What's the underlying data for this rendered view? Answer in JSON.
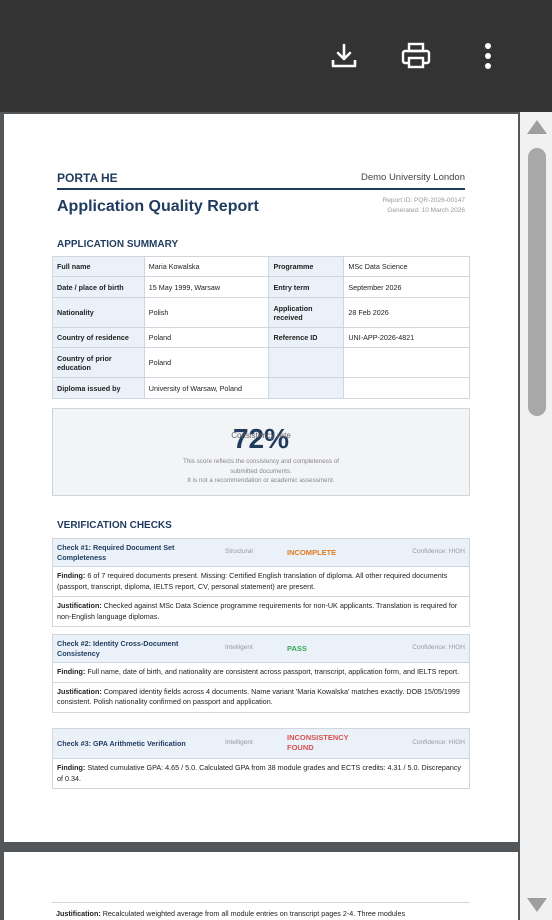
{
  "toolbar": {
    "icons": [
      "download-icon",
      "print-icon",
      "more-vert-icon"
    ]
  },
  "report": {
    "brand": "PORTA HE",
    "university": "Demo University London",
    "title": "Application Quality Report",
    "report_id": "Report ID: PQR-2026-00147",
    "generated": "Generated: 10 March 2026"
  },
  "summary": {
    "heading": "APPLICATION SUMMARY",
    "rows": [
      {
        "k1": "Full name",
        "v1": "Maria Kowalska",
        "k2": "Programme",
        "v2": "MSc Data Science"
      },
      {
        "k1": "Date / place of birth",
        "v1": "15 May 1999, Warsaw",
        "k2": "Entry term",
        "v2": "September 2026"
      },
      {
        "k1": "Nationality",
        "v1": "Polish",
        "k2": "Application received",
        "v2": "28 Feb 2026"
      },
      {
        "k1": "Country of residence",
        "v1": "Poland",
        "k2": "Reference ID",
        "v2": "UNI-APP-2026-4821"
      },
      {
        "k1": "Country of prior education",
        "v1": "Poland",
        "k2": "",
        "v2": ""
      },
      {
        "k1": "Diploma issued by",
        "v1": "University of Warsaw, Poland",
        "k2": "",
        "v2": ""
      }
    ]
  },
  "score": {
    "value": "72%",
    "label": "Consistency rate",
    "desc1": "This score reflects the consistency and completeness of",
    "desc2": "submitted documents.",
    "desc3": "It is not a recommendation or academic assessment."
  },
  "checks": {
    "heading": "VERIFICATION CHECKS",
    "items": [
      {
        "title": "Check #1: Required Document Set Completeness",
        "type": "Structural",
        "status": "INCOMPLETE",
        "status_color": "#e07b1f",
        "confidence": "Confidence: HIGH",
        "finding_label": "Finding:",
        "finding": "6 of 7 required documents present. Missing: Certified English translation of diploma. All other required documents (passport, transcript, diploma, IELTS report, CV, personal statement) are present.",
        "justification_label": "Justification:",
        "justification": "Checked against MSc Data Science programme requirements for non-UK applicants. Translation is required for non-English language diplomas."
      },
      {
        "title": "Check #2: Identity Cross-Document Consistency",
        "type": "Intelligent",
        "status": "PASS",
        "status_color": "#3aa655",
        "confidence": "Confidence: HIGH",
        "finding_label": "Finding:",
        "finding": "Full name, date of birth, and nationality are consistent across passport, transcript, application form, and IELTS report.",
        "justification_label": "Justification:",
        "justification": "Compared identity fields across 4 documents. Name variant 'Maria Kowalska' matches exactly. DOB 15/05/1999 consistent. Polish nationality confirmed on passport and application."
      },
      {
        "title": "Check #3: GPA Arithmetic Verification",
        "type": "Intelligent",
        "status": "INCONSISTENCY FOUND",
        "status_color": "#d9534f",
        "confidence": "Confidence: HIGH",
        "finding_label": "Finding:",
        "finding": "Stated cumulative GPA: 4.65 / 5.0. Calculated GPA from 38 module grades and ECTS credits: 4.31 / 5.0. Discrepancy of 0.34.",
        "justification_label": "Justification:",
        "justification": "Recalculated weighted average from all module entries on transcript pages 2-4. Three modules"
      }
    ]
  }
}
